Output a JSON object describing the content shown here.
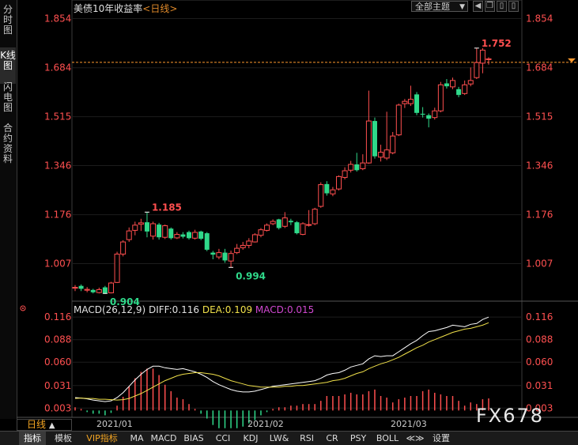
{
  "header": {
    "title": "美债10年收益率",
    "period_tag": "<日线>",
    "theme_label": "全部主题",
    "theme_arrow": "▼"
  },
  "sidebar": {
    "items": [
      {
        "label": "分时图",
        "active": false
      },
      {
        "label": "K线图",
        "active": true
      },
      {
        "label": "闪电图",
        "active": false
      },
      {
        "label": "合约资料",
        "active": false
      }
    ]
  },
  "period_selector": {
    "label": "日线",
    "arrow": "▲"
  },
  "watermark": "FX678",
  "bottom_bar": [
    {
      "label": "指标",
      "active": true
    },
    {
      "label": "模板"
    },
    {
      "label": "VIP指标",
      "vip": true
    },
    {
      "label": "MA"
    },
    {
      "label": "MACD"
    },
    {
      "label": "BIAS"
    },
    {
      "label": "CCI"
    },
    {
      "label": "KDJ"
    },
    {
      "label": "LW&"
    },
    {
      "label": "RSI"
    },
    {
      "label": "CR"
    },
    {
      "label": "PSY"
    },
    {
      "label": "BOLL"
    },
    {
      "label": "≪≫"
    },
    {
      "label": "设置"
    }
  ],
  "colors": {
    "up": "#ff4f4f",
    "down": "#2fd98a",
    "diff": "#ffffff",
    "dea": "#f0e04a",
    "macd_label": "#d048d0",
    "price_axis": "#ff5050",
    "current_line": "#ff9a2e"
  },
  "chart_data": [
    {
      "type": "candlestick",
      "title": "美债10年收益率",
      "yticks": [
        "1.854",
        "1.684",
        "1.515",
        "1.346",
        "1.176",
        "1.007"
      ],
      "ylim": [
        0.88,
        1.88
      ],
      "xticks": [
        "2021/01",
        "2021/02",
        "2021/03"
      ],
      "current_value": "1.752",
      "annotations": [
        {
          "text": "1.185",
          "kind": "high"
        },
        {
          "text": "0.904",
          "kind": "low"
        },
        {
          "text": "0.994",
          "kind": "low"
        },
        {
          "text": "1.752",
          "kind": "high"
        }
      ],
      "candles": [
        {
          "o": 0.922,
          "c": 0.925,
          "h": 0.933,
          "l": 0.912
        },
        {
          "o": 0.93,
          "c": 0.92,
          "h": 0.935,
          "l": 0.912
        },
        {
          "o": 0.915,
          "c": 0.918,
          "h": 0.926,
          "l": 0.908
        },
        {
          "o": 0.916,
          "c": 0.908,
          "h": 0.92,
          "l": 0.904
        },
        {
          "o": 0.907,
          "c": 0.917,
          "h": 0.924,
          "l": 0.904
        },
        {
          "o": 0.925,
          "c": 0.905,
          "h": 0.93,
          "l": 0.902
        },
        {
          "o": 0.906,
          "c": 0.94,
          "h": 0.944,
          "l": 0.904
        },
        {
          "o": 0.942,
          "c": 1.04,
          "h": 1.048,
          "l": 0.94
        },
        {
          "o": 1.04,
          "c": 1.082,
          "h": 1.088,
          "l": 1.032
        },
        {
          "o": 1.09,
          "c": 1.12,
          "h": 1.132,
          "l": 1.082
        },
        {
          "o": 1.122,
          "c": 1.14,
          "h": 1.152,
          "l": 1.105
        },
        {
          "o": 1.143,
          "c": 1.148,
          "h": 1.162,
          "l": 1.12
        },
        {
          "o": 1.15,
          "c": 1.118,
          "h": 1.185,
          "l": 1.098
        },
        {
          "o": 1.102,
          "c": 1.145,
          "h": 1.152,
          "l": 1.09
        },
        {
          "o": 1.142,
          "c": 1.098,
          "h": 1.148,
          "l": 1.09
        },
        {
          "o": 1.098,
          "c": 1.138,
          "h": 1.142,
          "l": 1.092
        },
        {
          "o": 1.128,
          "c": 1.095,
          "h": 1.132,
          "l": 1.09
        },
        {
          "o": 1.096,
          "c": 1.108,
          "h": 1.116,
          "l": 1.092
        },
        {
          "o": 1.108,
          "c": 1.1,
          "h": 1.116,
          "l": 1.094
        },
        {
          "o": 1.116,
          "c": 1.095,
          "h": 1.121,
          "l": 1.09
        },
        {
          "o": 1.095,
          "c": 1.115,
          "h": 1.124,
          "l": 1.09
        },
        {
          "o": 1.118,
          "c": 1.093,
          "h": 1.121,
          "l": 1.088
        },
        {
          "o": 1.112,
          "c": 1.055,
          "h": 1.116,
          "l": 1.05
        },
        {
          "o": 1.045,
          "c": 1.038,
          "h": 1.051,
          "l": 1.022
        },
        {
          "o": 1.03,
          "c": 1.045,
          "h": 1.058,
          "l": 1.022
        },
        {
          "o": 1.045,
          "c": 1.018,
          "h": 1.058,
          "l": 1.01
        },
        {
          "o": 1.016,
          "c": 1.042,
          "h": 1.052,
          "l": 0.994
        },
        {
          "o": 1.045,
          "c": 1.06,
          "h": 1.075,
          "l": 1.04
        },
        {
          "o": 1.062,
          "c": 1.07,
          "h": 1.082,
          "l": 1.055
        },
        {
          "o": 1.07,
          "c": 1.085,
          "h": 1.095,
          "l": 1.06
        },
        {
          "o": 1.082,
          "c": 1.107,
          "h": 1.112,
          "l": 1.08
        },
        {
          "o": 1.105,
          "c": 1.124,
          "h": 1.13,
          "l": 1.098
        },
        {
          "o": 1.122,
          "c": 1.14,
          "h": 1.146,
          "l": 1.118
        },
        {
          "o": 1.145,
          "c": 1.153,
          "h": 1.16,
          "l": 1.14
        },
        {
          "o": 1.16,
          "c": 1.13,
          "h": 1.162,
          "l": 1.125
        },
        {
          "o": 1.136,
          "c": 1.165,
          "h": 1.185,
          "l": 1.13
        },
        {
          "o": 1.155,
          "c": 1.15,
          "h": 1.162,
          "l": 1.14
        },
        {
          "o": 1.15,
          "c": 1.112,
          "h": 1.154,
          "l": 1.108
        },
        {
          "o": 1.108,
          "c": 1.145,
          "h": 1.15,
          "l": 1.105
        },
        {
          "o": 1.14,
          "c": 1.142,
          "h": 1.192,
          "l": 1.135
        },
        {
          "o": 1.145,
          "c": 1.195,
          "h": 1.2,
          "l": 1.14
        },
        {
          "o": 1.205,
          "c": 1.28,
          "h": 1.288,
          "l": 1.2
        },
        {
          "o": 1.282,
          "c": 1.25,
          "h": 1.292,
          "l": 1.242
        },
        {
          "o": 1.248,
          "c": 1.262,
          "h": 1.272,
          "l": 1.24
        },
        {
          "o": 1.265,
          "c": 1.308,
          "h": 1.312,
          "l": 1.26
        },
        {
          "o": 1.305,
          "c": 1.328,
          "h": 1.34,
          "l": 1.298
        },
        {
          "o": 1.33,
          "c": 1.35,
          "h": 1.362,
          "l": 1.322
        },
        {
          "o": 1.35,
          "c": 1.33,
          "h": 1.39,
          "l": 1.325
        },
        {
          "o": 1.335,
          "c": 1.355,
          "h": 1.385,
          "l": 1.33
        },
        {
          "o": 1.355,
          "c": 1.5,
          "h": 1.605,
          "l": 1.352
        },
        {
          "o": 1.5,
          "c": 1.378,
          "h": 1.512,
          "l": 1.37
        },
        {
          "o": 1.375,
          "c": 1.392,
          "h": 1.418,
          "l": 1.36
        },
        {
          "o": 1.372,
          "c": 1.4,
          "h": 1.532,
          "l": 1.365
        },
        {
          "o": 1.39,
          "c": 1.448,
          "h": 1.462,
          "l": 1.385
        },
        {
          "o": 1.452,
          "c": 1.555,
          "h": 1.56,
          "l": 1.448
        },
        {
          "o": 1.56,
          "c": 1.568,
          "h": 1.576,
          "l": 1.545
        },
        {
          "o": 1.56,
          "c": 1.575,
          "h": 1.622,
          "l": 1.552
        },
        {
          "o": 1.592,
          "c": 1.528,
          "h": 1.6,
          "l": 1.52
        },
        {
          "o": 1.525,
          "c": 1.522,
          "h": 1.548,
          "l": 1.512
        },
        {
          "o": 1.52,
          "c": 1.508,
          "h": 1.526,
          "l": 1.478
        },
        {
          "o": 1.512,
          "c": 1.535,
          "h": 1.546,
          "l": 1.505
        },
        {
          "o": 1.535,
          "c": 1.625,
          "h": 1.635,
          "l": 1.53
        },
        {
          "o": 1.63,
          "c": 1.62,
          "h": 1.645,
          "l": 1.612
        },
        {
          "o": 1.618,
          "c": 1.64,
          "h": 1.65,
          "l": 1.61
        },
        {
          "o": 1.61,
          "c": 1.59,
          "h": 1.618,
          "l": 1.582
        },
        {
          "o": 1.595,
          "c": 1.625,
          "h": 1.64,
          "l": 1.59
        },
        {
          "o": 1.628,
          "c": 1.64,
          "h": 1.685,
          "l": 1.62
        },
        {
          "o": 1.65,
          "c": 1.702,
          "h": 1.752,
          "l": 1.645
        },
        {
          "o": 1.7,
          "c": 1.745,
          "h": 1.752,
          "l": 1.665
        },
        {
          "o": 1.712,
          "c": 1.715,
          "h": 1.72,
          "l": 1.695
        }
      ]
    },
    {
      "type": "line",
      "title": "MACD(26,12,9)",
      "series": [
        {
          "name": "DIFF",
          "last": "0.116",
          "values": [
            0.016,
            0.0155,
            0.0145,
            0.013,
            0.012,
            0.011,
            0.012,
            0.016,
            0.022,
            0.03,
            0.038,
            0.045,
            0.051,
            0.055,
            0.055,
            0.053,
            0.052,
            0.051,
            0.052,
            0.05,
            0.048,
            0.045,
            0.041,
            0.036,
            0.032,
            0.029,
            0.026,
            0.024,
            0.023,
            0.023,
            0.024,
            0.026,
            0.028,
            0.03,
            0.031,
            0.032,
            0.033,
            0.034,
            0.035,
            0.036,
            0.037,
            0.04,
            0.044,
            0.046,
            0.047,
            0.05,
            0.054,
            0.056,
            0.058,
            0.064,
            0.068,
            0.067,
            0.068,
            0.068,
            0.073,
            0.078,
            0.083,
            0.087,
            0.093,
            0.098,
            0.099,
            0.101,
            0.103,
            0.106,
            0.105,
            0.104,
            0.107,
            0.108,
            0.113,
            0.116
          ]
        },
        {
          "name": "DEA",
          "last": "0.109",
          "values": [
            0.015,
            0.0155,
            0.015,
            0.015,
            0.014,
            0.014,
            0.0135,
            0.013,
            0.0135,
            0.015,
            0.018,
            0.021,
            0.025,
            0.029,
            0.033,
            0.037,
            0.04,
            0.043,
            0.045,
            0.046,
            0.047,
            0.047,
            0.046,
            0.045,
            0.043,
            0.04,
            0.037,
            0.035,
            0.033,
            0.031,
            0.03,
            0.029,
            0.029,
            0.029,
            0.029,
            0.03,
            0.03,
            0.031,
            0.031,
            0.032,
            0.033,
            0.034,
            0.035,
            0.037,
            0.038,
            0.04,
            0.043,
            0.046,
            0.048,
            0.052,
            0.055,
            0.058,
            0.06,
            0.063,
            0.066,
            0.07,
            0.074,
            0.078,
            0.081,
            0.085,
            0.088,
            0.091,
            0.094,
            0.097,
            0.099,
            0.101,
            0.102,
            0.104,
            0.106,
            0.109
          ]
        },
        {
          "name": "MACD",
          "last": "0.015",
          "values": [
            0.004,
            0.002,
            -0.002,
            -0.004,
            -0.004,
            -0.006,
            -0.003,
            0.006,
            0.017,
            0.03,
            0.04,
            0.048,
            0.052,
            0.052,
            0.044,
            0.032,
            0.024,
            0.016,
            0.014,
            0.008,
            0.002,
            -0.004,
            -0.01,
            -0.018,
            -0.022,
            -0.022,
            -0.022,
            -0.022,
            -0.02,
            -0.016,
            -0.012,
            -0.006,
            -0.002,
            0.002,
            0.004,
            0.004,
            0.006,
            0.006,
            0.008,
            0.008,
            0.008,
            0.012,
            0.018,
            0.018,
            0.018,
            0.02,
            0.022,
            0.02,
            0.02,
            0.024,
            0.026,
            0.018,
            0.016,
            0.01,
            0.014,
            0.016,
            0.018,
            0.018,
            0.024,
            0.026,
            0.022,
            0.02,
            0.018,
            0.018,
            0.012,
            0.006,
            0.01,
            0.008,
            0.014,
            0.015
          ]
        }
      ],
      "yticks": [
        "0.116",
        "0.088",
        "0.060",
        "0.031",
        "0.003"
      ],
      "ylim": [
        -0.0085,
        0.125
      ]
    }
  ]
}
